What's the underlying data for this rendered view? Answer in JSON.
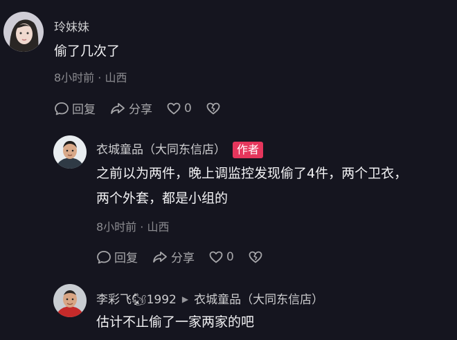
{
  "comments": [
    {
      "author": "玲妹妹",
      "text": "偷了几次了",
      "meta": "8小时前 · 山西",
      "reply_label": "回复",
      "share_label": "分享",
      "likes": "0"
    },
    {
      "author": "衣城童品（大同东信店）",
      "badge": "作者",
      "text_line1": "之前以为两件，晚上调监控发现偷了4件，两个卫衣，",
      "text_line2": "两个外套，都是小组的",
      "meta": "8小时前 · 山西",
      "reply_label": "回复",
      "share_label": "分享",
      "likes": "0"
    },
    {
      "author": "李彩飞🐿1992",
      "reply_to": "衣城童品（大同东信店）",
      "text": "估计不止偷了一家两家的吧"
    }
  ],
  "colors": {
    "background": "#15151f",
    "author_badge": "#e5365c"
  }
}
